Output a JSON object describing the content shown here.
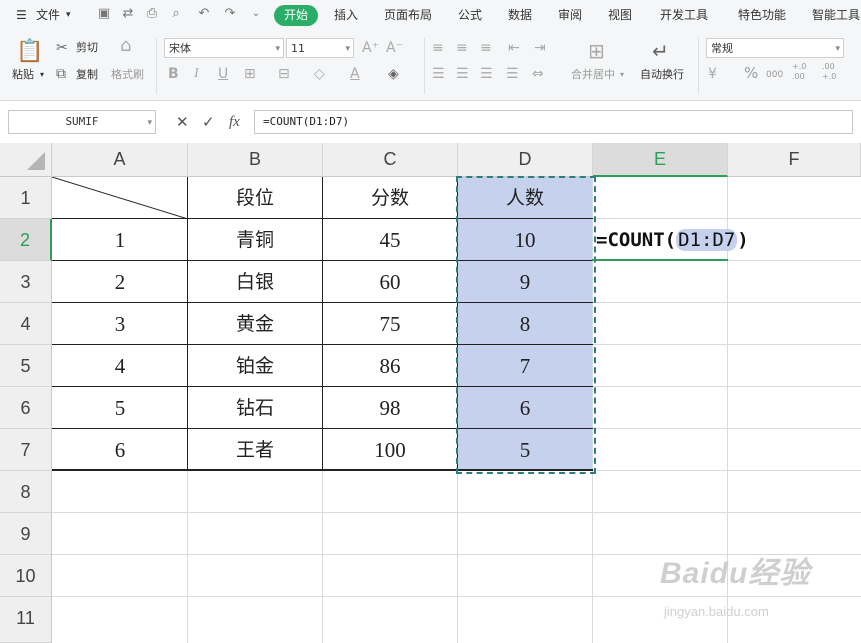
{
  "menubar": {
    "file_label": "文件",
    "tabs": [
      "开始",
      "插入",
      "页面布局",
      "公式",
      "数据",
      "审阅",
      "视图",
      "开发工具",
      "特色功能",
      "智能工具"
    ]
  },
  "ribbon": {
    "paste": "粘贴",
    "cut": "剪切",
    "copy": "复制",
    "format_painter": "格式刷",
    "font_name": "宋体",
    "font_size": "11",
    "merge_center": "合并居中",
    "wrap_text": "自动换行",
    "number_format": "常规",
    "percent": "%",
    "increase_decimal": "+.0 .00",
    "decrease_decimal": ".00 +.0",
    "thousands": "000"
  },
  "formula_bar": {
    "name_box": "SUMIF",
    "fx": "fx",
    "formula": "=COUNT(D1:D7)"
  },
  "sheet": {
    "columns": [
      "A",
      "B",
      "C",
      "D",
      "E",
      "F"
    ],
    "selected_column": "E",
    "rows": [
      "1",
      "2",
      "3",
      "4",
      "5",
      "6",
      "7",
      "8",
      "9",
      "10",
      "11"
    ],
    "selected_row": "2",
    "header_row": {
      "b": "段位",
      "c": "分数",
      "d": "人数"
    },
    "data_rows": [
      {
        "a": "1",
        "b": "青铜",
        "c": "45",
        "d": "10"
      },
      {
        "a": "2",
        "b": "白银",
        "c": "60",
        "d": "9"
      },
      {
        "a": "3",
        "b": "黄金",
        "c": "75",
        "d": "8"
      },
      {
        "a": "4",
        "b": "铂金",
        "c": "86",
        "d": "7"
      },
      {
        "a": "5",
        "b": "钻石",
        "c": "98",
        "d": "6"
      },
      {
        "a": "6",
        "b": "王者",
        "c": "100",
        "d": "5"
      }
    ],
    "editing_cell": {
      "prefix": "=COUNT(",
      "ref": "D1:D7",
      "suffix": ")"
    }
  },
  "watermark": {
    "brand": "Baidu经验",
    "url": "jingyan.baidu.com"
  },
  "colors": {
    "accent_green": "#2aae67",
    "selection_fill": "#c6d1ee",
    "ref_border": "#2e7d7d"
  }
}
